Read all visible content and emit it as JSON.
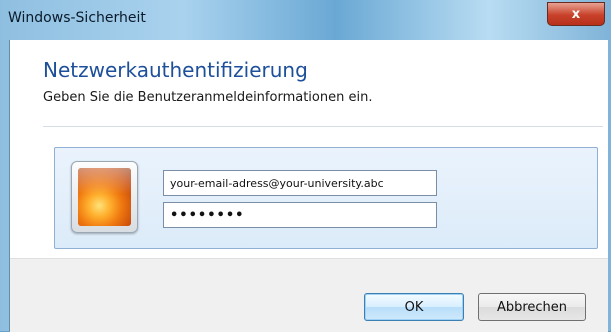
{
  "window": {
    "title": "Windows-Sicherheit",
    "close_glyph": "x"
  },
  "dialog": {
    "heading": "Netzwerkauthentifizierung",
    "instruction": "Geben Sie die Benutzeranmeldeinformationen ein."
  },
  "credentials": {
    "username_value": "your-email-adress@your-university.abc",
    "password_value": "••••••••",
    "avatar_icon": "user-tile-flower-icon"
  },
  "buttons": {
    "ok_label": "OK",
    "cancel_label": "Abbrechen"
  },
  "colors": {
    "heading": "#1e4f9a",
    "ok_border": "#3c7fb1",
    "close_button": "#c8412a"
  }
}
